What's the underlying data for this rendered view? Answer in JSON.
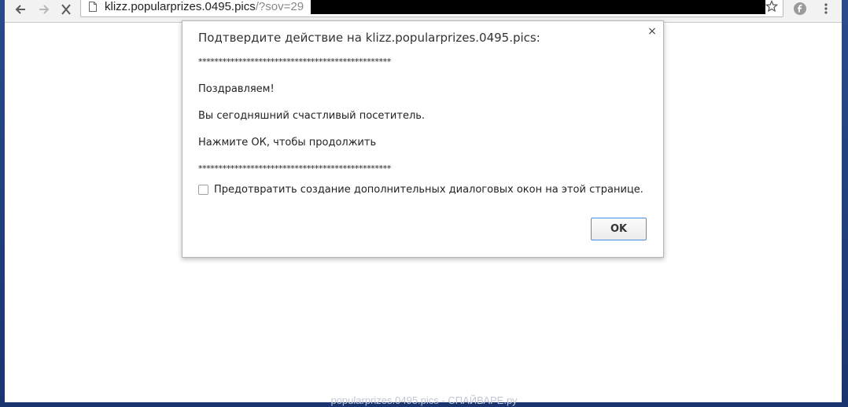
{
  "browser": {
    "url_host": "klizz.popularprizes.0495.pics",
    "url_path": "/?sov=29",
    "icons": {
      "back": "back-arrow-icon",
      "forward": "forward-arrow-icon",
      "stop": "stop-icon",
      "page": "page-icon",
      "bookmark": "star-icon",
      "extension": "extension-icon",
      "menu": "menu-icon"
    }
  },
  "dialog": {
    "title": "Подтвердите действие на klizz.popularprizes.0495.pics:",
    "close_label": "×",
    "stars_top": "************************************************",
    "line1": "Поздравляем!",
    "line2": "Вы сегодняшний счастливый посетитель.",
    "line3": "Нажмите ОК, чтобы продолжить",
    "stars_bottom": "************************************************",
    "suppress_label": "Предотвратить создание дополнительных диалоговых окон на этой странице.",
    "ok_label": "OK"
  },
  "watermark": "popularprizes.0495.pics - СПАЙВАРЕ.ру"
}
